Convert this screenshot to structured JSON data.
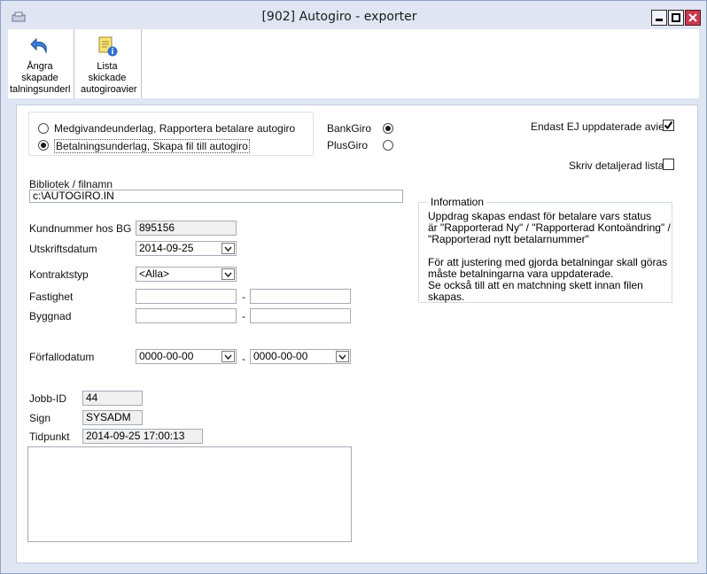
{
  "window": {
    "title": "[902]  Autogiro - exporter",
    "controls": [
      "minimize-icon",
      "maximize-icon",
      "close-icon"
    ]
  },
  "toolbar": {
    "undo_label": "Ångra skapade talningsunderl",
    "list_label": "Lista skickade autogiroavier"
  },
  "mode": {
    "option1": "Medgivandeunderlag, Rapportera betalare autogiro",
    "option2": "Betalningsunderlag, Skapa fil till autogiro",
    "selected": "option2"
  },
  "giro": {
    "bankgiro": "BankGiro",
    "plusgiro": "PlusGiro",
    "selected": "bankgiro"
  },
  "options": {
    "only_not_updated_label": "Endast EJ uppdaterade avier",
    "only_not_updated_checked": true,
    "detailed_list_label": "Skriv detaljerad lista",
    "detailed_list_checked": false
  },
  "form": {
    "library_label": "Bibliotek / filnamn",
    "library_value": "c:\\AUTOGIRO.IN",
    "customer_no_label": "Kundnummer hos BG",
    "customer_no_value": "895156",
    "print_date_label": "Utskriftsdatum",
    "print_date_value": "2014-09-25",
    "contract_type_label": "Kontraktstyp",
    "contract_type_value": "<Alla>",
    "property_label": "Fastighet",
    "property_from": "",
    "property_to": "",
    "building_label": "Byggnad",
    "building_from": "",
    "building_to": "",
    "range_sep": "-",
    "due_date_label": "Förfallodatum",
    "due_date_from": "0000-00-00",
    "due_date_to": "0000-00-00"
  },
  "job": {
    "job_id_label": "Jobb-ID",
    "job_id_value": "44",
    "sign_label": "Sign",
    "sign_value": "SYSADM",
    "time_label": "Tidpunkt",
    "time_value": "2014-09-25 17:00:13",
    "log_text": ""
  },
  "information": {
    "title": "Information",
    "paragraph1": "Uppdrag skapas endast för betalare vars status\när \"Rapporterad Ny\" / \"Rapporterad Kontoändring\" /\n\"Rapporterad nytt betalarnummer\"",
    "paragraph2": "För att justering med gjorda betalningar skall göras\nmåste betalningarna vara uppdaterade.\nSe också till att en matchning skett innan filen skapas."
  }
}
